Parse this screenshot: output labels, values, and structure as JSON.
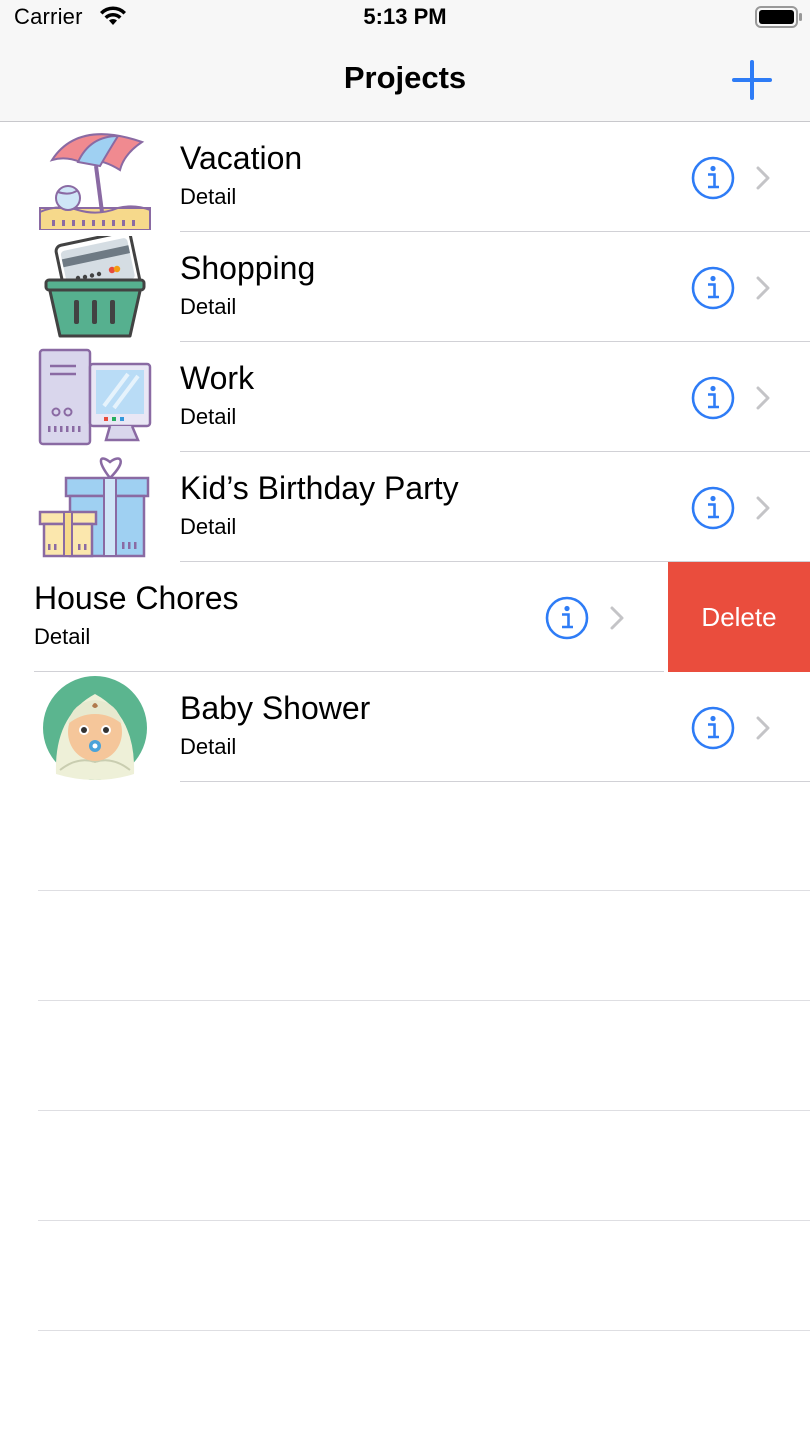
{
  "status_bar": {
    "carrier": "Carrier",
    "time": "5:13 PM"
  },
  "nav": {
    "title": "Projects"
  },
  "rows": [
    {
      "title": "Vacation",
      "detail": "Detail",
      "icon": "beach-umbrella-icon"
    },
    {
      "title": "Shopping",
      "detail": "Detail",
      "icon": "shopping-basket-icon"
    },
    {
      "title": "Work",
      "detail": "Detail",
      "icon": "computer-icon"
    },
    {
      "title": "Kid’s Birthday Party",
      "detail": "Detail",
      "icon": "gift-icon"
    },
    {
      "title": "House Chores",
      "detail": "Detail",
      "swiped": true,
      "delete_label": "Delete"
    },
    {
      "title": "Baby Shower",
      "detail": "Detail",
      "icon": "baby-icon"
    }
  ],
  "colors": {
    "accent": "#2e7cf6",
    "delete": "#ea4d3d",
    "separator": "#d1d1d6",
    "chevron": "#c4c4c7"
  }
}
